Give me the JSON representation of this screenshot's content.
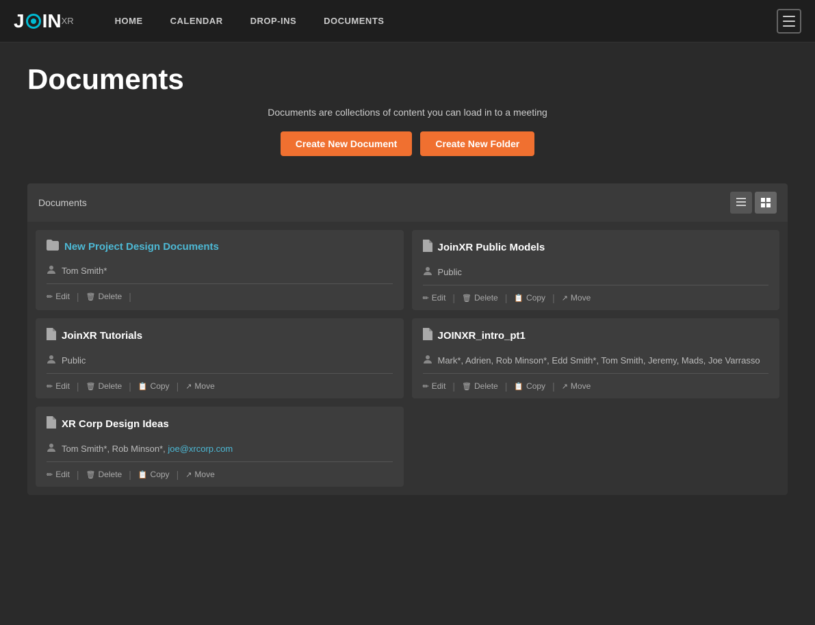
{
  "nav": {
    "links": [
      {
        "label": "HOME",
        "id": "home"
      },
      {
        "label": "CALENDAR",
        "id": "calendar"
      },
      {
        "label": "DROP-INS",
        "id": "drop-ins"
      },
      {
        "label": "DOCUMENTS",
        "id": "documents"
      }
    ]
  },
  "header": {
    "title": "Documents",
    "subtitle": "Documents are collections of content you can load in to a meeting",
    "create_doc_label": "Create New Document",
    "create_folder_label": "Create New Folder"
  },
  "panel": {
    "title": "Documents"
  },
  "cards": [
    {
      "id": "new-project-design",
      "type": "folder",
      "title": "New Project Design Documents",
      "owner": "Tom Smith*",
      "actions": [
        "Edit",
        "Delete"
      ],
      "is_link": true
    },
    {
      "id": "joinxr-public-models",
      "type": "doc",
      "title": "JoinXR Public Models",
      "owner": "Public",
      "actions": [
        "Edit",
        "Delete",
        "Copy",
        "Move"
      ],
      "is_link": false
    },
    {
      "id": "joinxr-tutorials",
      "type": "doc",
      "title": "JoinXR Tutorials",
      "owner": "Public",
      "actions": [
        "Edit",
        "Delete",
        "Copy",
        "Move"
      ],
      "is_link": false
    },
    {
      "id": "joinxr-intro",
      "type": "doc",
      "title": "JOINXR_intro_pt1",
      "owner": "Mark*, Adrien, Rob Minson*, Edd Smith*, Tom Smith, Jeremy, Mads, Joe Varrasso",
      "actions": [
        "Edit",
        "Delete",
        "Copy",
        "Move"
      ],
      "is_link": false
    },
    {
      "id": "xr-corp-design",
      "type": "doc",
      "title": "XR Corp Design Ideas",
      "owner_parts": [
        "Tom Smith*, Rob Minson*, ",
        "joe@xrcorp.com"
      ],
      "actions": [
        "Edit",
        "Delete",
        "Copy",
        "Move"
      ],
      "is_link": false
    }
  ],
  "icons": {
    "folder": "📁",
    "doc": "📄",
    "edit": "✏",
    "delete": "🗑",
    "copy": "📋",
    "move": "↗",
    "person": "👤",
    "list_view": "≡",
    "grid_view": "⊞"
  }
}
